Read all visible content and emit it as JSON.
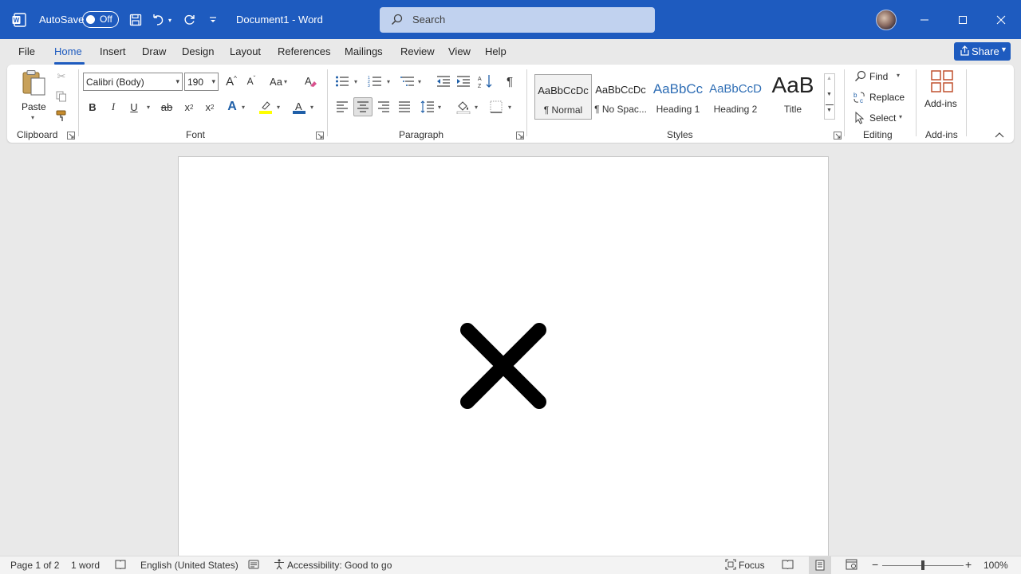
{
  "titlebar": {
    "autosave_label": "AutoSave",
    "autosave_state": "Off",
    "doc_title": "Document1  -  Word",
    "search_placeholder": "Search"
  },
  "tabs": [
    "File",
    "Home",
    "Insert",
    "Draw",
    "Design",
    "Layout",
    "References",
    "Mailings",
    "Review",
    "View",
    "Help"
  ],
  "active_tab": "Home",
  "share_label": "Share",
  "ribbon": {
    "clipboard": {
      "paste_label": "Paste",
      "group_label": "Clipboard"
    },
    "font": {
      "font_name": "Calibri (Body)",
      "font_size": "190",
      "group_label": "Font"
    },
    "paragraph": {
      "group_label": "Paragraph"
    },
    "styles": {
      "group_label": "Styles",
      "items": [
        {
          "preview": "AaBbCcDc",
          "name": "¶ Normal"
        },
        {
          "preview": "AaBbCcDc",
          "name": "¶ No Spac..."
        },
        {
          "preview": "AaBbCc",
          "name": "Heading 1"
        },
        {
          "preview": "AaBbCcD",
          "name": "Heading 2"
        },
        {
          "preview": "AaB",
          "name": "Title"
        }
      ]
    },
    "editing": {
      "find_label": "Find",
      "replace_label": "Replace",
      "select_label": "Select",
      "group_label": "Editing"
    },
    "addins": {
      "button_label": "Add-ins",
      "group_label": "Add-ins"
    }
  },
  "statusbar": {
    "page": "Page 1 of 2",
    "words": "1 word",
    "language": "English (United States)",
    "accessibility": "Accessibility: Good to go",
    "focus": "Focus",
    "zoom": "100%"
  },
  "colors": {
    "accent": "#1e5bbf",
    "highlight": "#ffff00",
    "font_color": "#1f5fa8"
  }
}
